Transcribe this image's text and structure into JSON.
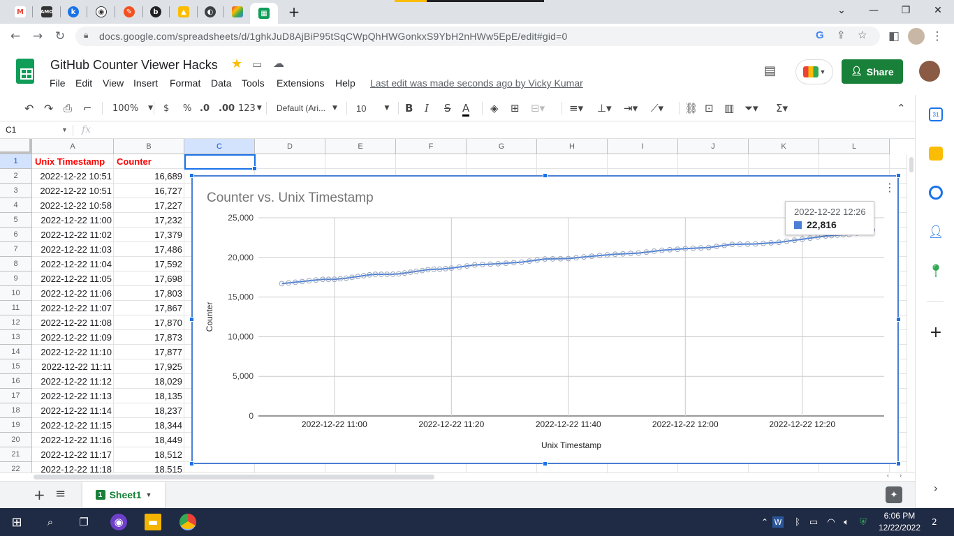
{
  "browser": {
    "tabs": [
      "gmail",
      "amo",
      "k",
      "github",
      "orange",
      "b",
      "drive",
      "cursor",
      "colorwheel",
      "sheets"
    ],
    "new_tab_label": "+",
    "url": "docs.google.com/spreadsheets/d/1ghkJuD8AjBiP95tSqCWpQhHWGonkxS9YbH2nHWw5EpE/edit#gid=0"
  },
  "doc": {
    "title": "GitHub Counter Viewer Hacks",
    "menu": [
      "File",
      "Edit",
      "View",
      "Insert",
      "Format",
      "Data",
      "Tools",
      "Extensions",
      "Help"
    ],
    "last_edit": "Last edit was made seconds ago by Vicky Kumar",
    "share_label": "Share"
  },
  "toolbar": {
    "zoom": "100%",
    "currency": "$",
    "percent": "%",
    "dec_less": ".0",
    "dec_more": ".00",
    "more_formats": "123",
    "font": "Default (Ari...",
    "font_size": "10",
    "bold": "B",
    "italic": "I",
    "strike": "S",
    "text_color": "A"
  },
  "formula_bar": {
    "name_box": "C1",
    "fx": "fx"
  },
  "grid": {
    "columns": [
      "A",
      "B",
      "C",
      "D",
      "E",
      "F",
      "G",
      "H",
      "I",
      "J",
      "K",
      "L"
    ],
    "row_numbers": [
      "1",
      "2",
      "3",
      "4",
      "5",
      "6",
      "7",
      "8",
      "9",
      "10",
      "11",
      "12",
      "13",
      "14",
      "15",
      "16",
      "17",
      "18",
      "19",
      "20",
      "21",
      "22"
    ],
    "header": {
      "a": "Unix Timestamp",
      "b": "Counter"
    },
    "rows": [
      [
        "2022-12-22 10:51",
        "16,689"
      ],
      [
        "2022-12-22 10:51",
        "16,727"
      ],
      [
        "2022-12-22 10:58",
        "17,227"
      ],
      [
        "2022-12-22 11:00",
        "17,232"
      ],
      [
        "2022-12-22 11:02",
        "17,379"
      ],
      [
        "2022-12-22 11:03",
        "17,486"
      ],
      [
        "2022-12-22 11:04",
        "17,592"
      ],
      [
        "2022-12-22 11:05",
        "17,698"
      ],
      [
        "2022-12-22 11:06",
        "17,803"
      ],
      [
        "2022-12-22 11:07",
        "17,867"
      ],
      [
        "2022-12-22 11:08",
        "17,870"
      ],
      [
        "2022-12-22 11:09",
        "17,873"
      ],
      [
        "2022-12-22 11:10",
        "17,877"
      ],
      [
        "2022-12-22 11:11",
        "17,925"
      ],
      [
        "2022-12-22 11:12",
        "18,029"
      ],
      [
        "2022-12-22 11:13",
        "18,135"
      ],
      [
        "2022-12-22 11:14",
        "18,237"
      ],
      [
        "2022-12-22 11:15",
        "18,344"
      ],
      [
        "2022-12-22 11:16",
        "18,449"
      ],
      [
        "2022-12-22 11:17",
        "18,512"
      ],
      [
        "2022-12-22 11:18",
        "18,515"
      ]
    ]
  },
  "chart_data": {
    "type": "line",
    "title": "Counter vs. Unix Timestamp",
    "xlabel": "Unix Timestamp",
    "ylabel": "Counter",
    "ylim": [
      0,
      25000
    ],
    "yticks": [
      "0",
      "5,000",
      "10,000",
      "15,000",
      "20,000",
      "25,000"
    ],
    "xticks": [
      "2022-12-22 11:00",
      "2022-12-22 11:20",
      "2022-12-22 11:40",
      "2022-12-22 12:00",
      "2022-12-22 12:20"
    ],
    "grid": true,
    "color": "#4a7fd6",
    "series": [
      {
        "x": [
          "2022-12-22 10:51",
          "2022-12-22 10:58",
          "2022-12-22 11:00",
          "2022-12-22 11:02",
          "2022-12-22 11:03",
          "2022-12-22 11:04",
          "2022-12-22 11:05",
          "2022-12-22 11:06",
          "2022-12-22 11:07",
          "2022-12-22 11:08",
          "2022-12-22 11:09",
          "2022-12-22 11:10",
          "2022-12-22 11:11",
          "2022-12-22 11:12",
          "2022-12-22 11:13",
          "2022-12-22 11:14",
          "2022-12-22 11:15",
          "2022-12-22 11:16",
          "2022-12-22 11:17",
          "2022-12-22 11:18",
          "2022-12-22 11:20",
          "2022-12-22 11:24",
          "2022-12-22 11:28",
          "2022-12-22 11:32",
          "2022-12-22 11:36",
          "2022-12-22 11:40",
          "2022-12-22 11:44",
          "2022-12-22 11:48",
          "2022-12-22 11:52",
          "2022-12-22 11:56",
          "2022-12-22 12:00",
          "2022-12-22 12:04",
          "2022-12-22 12:08",
          "2022-12-22 12:12",
          "2022-12-22 12:16",
          "2022-12-22 12:20",
          "2022-12-22 12:24",
          "2022-12-22 12:26",
          "2022-12-22 12:28",
          "2022-12-22 12:32"
        ],
        "values": [
          16689,
          17227,
          17232,
          17379,
          17486,
          17592,
          17698,
          17803,
          17867,
          17870,
          17873,
          17877,
          17925,
          18029,
          18135,
          18237,
          18344,
          18449,
          18512,
          18515,
          18650,
          19050,
          19200,
          19400,
          19800,
          19850,
          20150,
          20400,
          20550,
          20900,
          21100,
          21250,
          21650,
          21700,
          21900,
          22300,
          22700,
          22816,
          22900,
          23450
        ]
      }
    ],
    "tooltip": {
      "label": "2022-12-22 12:26",
      "value": "22,816"
    }
  },
  "sheet_tabs": {
    "add": "+",
    "list": "≡",
    "active": "Sheet1",
    "badge": "1"
  },
  "taskbar": {
    "time": "6:06 PM",
    "date": "12/22/2022",
    "notifications": "2"
  }
}
